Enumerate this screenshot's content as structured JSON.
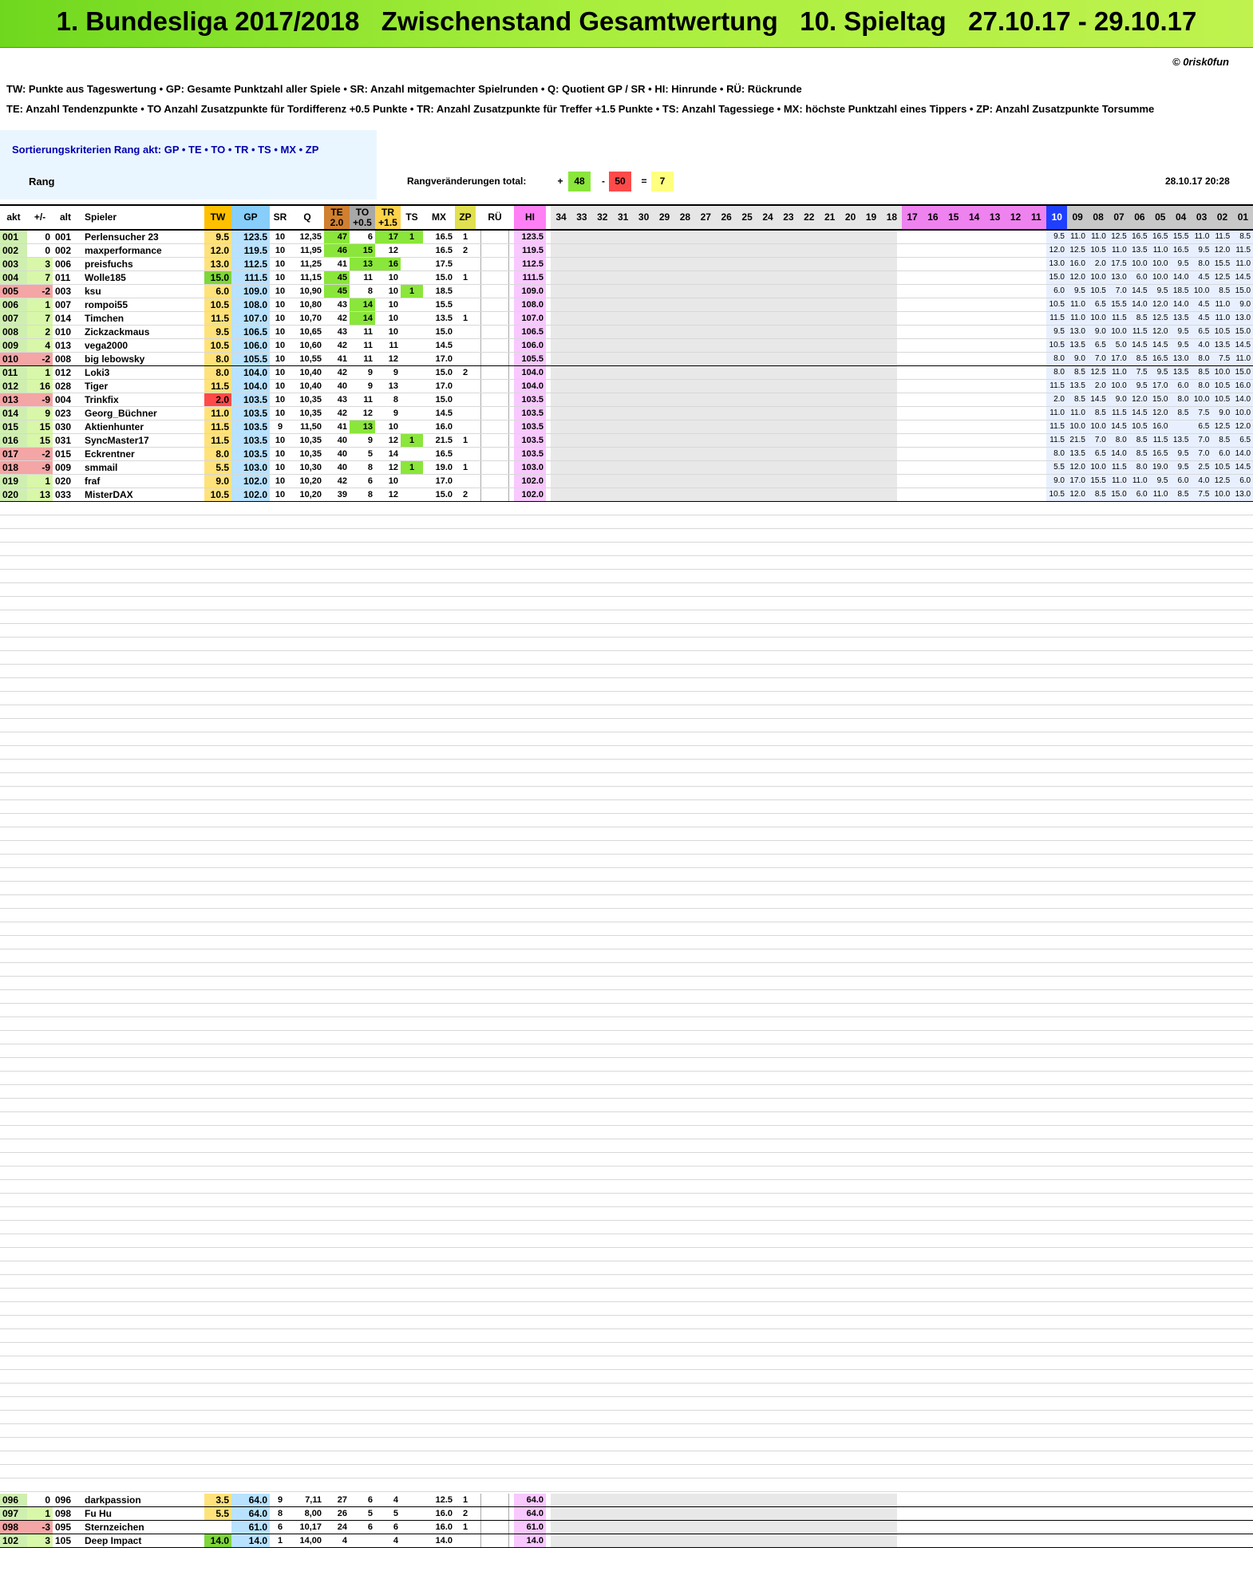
{
  "title": "1. Bundesliga 2017/2018   Zwischenstand Gesamtwertung   10. Spieltag   27.10.17 - 29.10.17",
  "copyright": "© 0risk0fun",
  "legend_line1": "TW: Punkte aus Tageswertung  •  GP: Gesamte Punktzahl aller Spiele  •  SR: Anzahl mitgemachter Spielrunden  •  Q: Quotient GP / SR  •  HI: Hinrunde  •  RÜ: Rückrunde",
  "legend_line2": "TE: Anzahl Tendenzpunkte  •  TO Anzahl Zusatzpunkte für Tordifferenz +0.5 Punkte  •  TR: Anzahl Zusatzpunkte für Treffer +1.5 Punkte  •  TS: Anzahl Tagessiege  •  MX: höchste Punktzahl eines Tippers  •  ZP: Anzahl Zusatzpunkte Torsumme",
  "sort_label": "Sortierungskriterien Rang akt:  GP  •  TE  •  TO  •  TR  •  TS  •  MX  •  ZP",
  "rang_label": "Rang",
  "changes": {
    "label": "Rangveränderungen total:",
    "plus_sign": "+",
    "plus": "48",
    "minus_sign": "-",
    "minus": "50",
    "eq_sign": "=",
    "eq": "7"
  },
  "date": "28.10.17  20:28",
  "headers": {
    "akt": "akt",
    "pm": "+/-",
    "alt": "alt",
    "spieler": "Spieler",
    "tw": "TW",
    "gp": "GP",
    "sr": "SR",
    "q": "Q",
    "te": "TE\n2.0",
    "to": "TO\n+0.5",
    "tr": "TR\n+1.5",
    "ts": "TS",
    "mx": "MX",
    "zp": "ZP",
    "ru": "RÜ",
    "hi": "HI"
  },
  "rounds_new": [
    "34",
    "33",
    "32",
    "31",
    "30",
    "29",
    "28",
    "27",
    "26",
    "25",
    "24",
    "23",
    "22",
    "21",
    "20",
    "19",
    "18"
  ],
  "rounds_old": [
    "17",
    "16",
    "15",
    "14",
    "13",
    "12",
    "11",
    "10",
    "09",
    "08",
    "07",
    "06",
    "05",
    "04",
    "03",
    "02",
    "01"
  ],
  "current_round": "10",
  "colors": {
    "banner": "#8ee82a",
    "tw": "#ffc000",
    "gp": "#87cefa",
    "hi": "#ff7ff5",
    "highlight": "#8ae63a",
    "down": "#f4a5a5"
  },
  "rows": [
    {
      "akt": "001",
      "pm": "0",
      "alt": "001",
      "name": "Perlensucher 23",
      "tw": "9.5",
      "gp": "123.5",
      "sr": "10",
      "q": "12,35",
      "te": "47",
      "to": "6",
      "tr": "17",
      "ts": "1",
      "mx": "16.5",
      "zp": "1",
      "hi": "123.5",
      "r": [
        "9.5",
        "11.0",
        "11.0",
        "12.5",
        "16.5",
        "16.5",
        "15.5",
        "11.0",
        "11.5",
        "8.5"
      ]
    },
    {
      "akt": "002",
      "pm": "0",
      "alt": "002",
      "name": "maxperformance",
      "tw": "12.0",
      "gp": "119.5",
      "sr": "10",
      "q": "11,95",
      "te": "46",
      "to": "15",
      "tr": "12",
      "ts": "",
      "mx": "16.5",
      "zp": "2",
      "hi": "119.5",
      "r": [
        "12.0",
        "12.5",
        "10.5",
        "11.0",
        "13.5",
        "11.0",
        "16.5",
        "9.5",
        "12.0",
        "11.5"
      ]
    },
    {
      "akt": "003",
      "pm": "3",
      "alt": "006",
      "name": "preisfuchs",
      "tw": "13.0",
      "gp": "112.5",
      "sr": "10",
      "q": "11,25",
      "te": "41",
      "to": "13",
      "tr": "16",
      "ts": "",
      "mx": "17.5",
      "zp": "",
      "hi": "112.5",
      "r": [
        "13.0",
        "16.0",
        "2.0",
        "17.5",
        "10.0",
        "10.0",
        "9.5",
        "8.0",
        "15.5",
        "11.0"
      ]
    },
    {
      "akt": "004",
      "pm": "7",
      "alt": "011",
      "name": "Wolle185",
      "tw": "15.0",
      "gp": "111.5",
      "sr": "10",
      "q": "11,15",
      "te": "45",
      "to": "11",
      "tr": "10",
      "ts": "",
      "mx": "15.0",
      "zp": "1",
      "hi": "111.5",
      "r": [
        "15.0",
        "12.0",
        "10.0",
        "13.0",
        "6.0",
        "10.0",
        "14.0",
        "4.5",
        "12.5",
        "14.5"
      ]
    },
    {
      "akt": "005",
      "pm": "-2",
      "alt": "003",
      "name": "ksu",
      "tw": "6.0",
      "gp": "109.0",
      "sr": "10",
      "q": "10,90",
      "te": "45",
      "to": "8",
      "tr": "10",
      "ts": "1",
      "mx": "18.5",
      "zp": "",
      "hi": "109.0",
      "r": [
        "6.0",
        "9.5",
        "10.5",
        "7.0",
        "14.5",
        "9.5",
        "18.5",
        "10.0",
        "8.5",
        "15.0"
      ]
    },
    {
      "akt": "006",
      "pm": "1",
      "alt": "007",
      "name": "rompoi55",
      "tw": "10.5",
      "gp": "108.0",
      "sr": "10",
      "q": "10,80",
      "te": "43",
      "to": "14",
      "tr": "10",
      "ts": "",
      "mx": "15.5",
      "zp": "",
      "hi": "108.0",
      "r": [
        "10.5",
        "11.0",
        "6.5",
        "15.5",
        "14.0",
        "12.0",
        "14.0",
        "4.5",
        "11.0",
        "9.0"
      ]
    },
    {
      "akt": "007",
      "pm": "7",
      "alt": "014",
      "name": "Timchen",
      "tw": "11.5",
      "gp": "107.0",
      "sr": "10",
      "q": "10,70",
      "te": "42",
      "to": "14",
      "tr": "10",
      "ts": "",
      "mx": "13.5",
      "zp": "1",
      "hi": "107.0",
      "r": [
        "11.5",
        "11.0",
        "10.0",
        "11.5",
        "8.5",
        "12.5",
        "13.5",
        "4.5",
        "11.0",
        "13.0"
      ]
    },
    {
      "akt": "008",
      "pm": "2",
      "alt": "010",
      "name": "Zickzackmaus",
      "tw": "9.5",
      "gp": "106.5",
      "sr": "10",
      "q": "10,65",
      "te": "43",
      "to": "11",
      "tr": "10",
      "ts": "",
      "mx": "15.0",
      "zp": "",
      "hi": "106.5",
      "r": [
        "9.5",
        "13.0",
        "9.0",
        "10.0",
        "11.5",
        "12.0",
        "9.5",
        "6.5",
        "10.5",
        "15.0"
      ]
    },
    {
      "akt": "009",
      "pm": "4",
      "alt": "013",
      "name": "vega2000",
      "tw": "10.5",
      "gp": "106.0",
      "sr": "10",
      "q": "10,60",
      "te": "42",
      "to": "11",
      "tr": "11",
      "ts": "",
      "mx": "14.5",
      "zp": "",
      "hi": "106.0",
      "r": [
        "10.5",
        "13.5",
        "6.5",
        "5.0",
        "14.5",
        "14.5",
        "9.5",
        "4.0",
        "13.5",
        "14.5"
      ]
    },
    {
      "akt": "010",
      "pm": "-2",
      "alt": "008",
      "name": "big lebowsky",
      "tw": "8.0",
      "gp": "105.5",
      "sr": "10",
      "q": "10,55",
      "te": "41",
      "to": "11",
      "tr": "12",
      "ts": "",
      "mx": "17.0",
      "zp": "",
      "hi": "105.5",
      "r": [
        "8.0",
        "9.0",
        "7.0",
        "17.0",
        "8.5",
        "16.5",
        "13.0",
        "8.0",
        "7.5",
        "11.0"
      ]
    },
    {
      "akt": "011",
      "pm": "1",
      "alt": "012",
      "name": "Loki3",
      "tw": "8.0",
      "gp": "104.0",
      "sr": "10",
      "q": "10,40",
      "te": "42",
      "to": "9",
      "tr": "9",
      "ts": "",
      "mx": "15.0",
      "zp": "2",
      "hi": "104.0",
      "r": [
        "8.0",
        "8.5",
        "12.5",
        "11.0",
        "7.5",
        "9.5",
        "13.5",
        "8.5",
        "10.0",
        "15.0"
      ]
    },
    {
      "akt": "012",
      "pm": "16",
      "alt": "028",
      "name": "Tiger",
      "tw": "11.5",
      "gp": "104.0",
      "sr": "10",
      "q": "10,40",
      "te": "40",
      "to": "9",
      "tr": "13",
      "ts": "",
      "mx": "17.0",
      "zp": "",
      "hi": "104.0",
      "r": [
        "11.5",
        "13.5",
        "2.0",
        "10.0",
        "9.5",
        "17.0",
        "6.0",
        "8.0",
        "10.5",
        "16.0"
      ]
    },
    {
      "akt": "013",
      "pm": "-9",
      "alt": "004",
      "name": "Trinkfix",
      "tw": "2.0",
      "gp": "103.5",
      "sr": "10",
      "q": "10,35",
      "te": "43",
      "to": "11",
      "tr": "8",
      "ts": "",
      "mx": "15.0",
      "zp": "",
      "hi": "103.5",
      "r": [
        "2.0",
        "8.5",
        "14.5",
        "9.0",
        "12.0",
        "15.0",
        "8.0",
        "10.0",
        "10.5",
        "14.0"
      ]
    },
    {
      "akt": "014",
      "pm": "9",
      "alt": "023",
      "name": "Georg_Büchner",
      "tw": "11.0",
      "gp": "103.5",
      "sr": "10",
      "q": "10,35",
      "te": "42",
      "to": "12",
      "tr": "9",
      "ts": "",
      "mx": "14.5",
      "zp": "",
      "hi": "103.5",
      "r": [
        "11.0",
        "11.0",
        "8.5",
        "11.5",
        "14.5",
        "12.0",
        "8.5",
        "7.5",
        "9.0",
        "10.0"
      ]
    },
    {
      "akt": "015",
      "pm": "15",
      "alt": "030",
      "name": "Aktienhunter",
      "tw": "11.5",
      "gp": "103.5",
      "sr": "9",
      "q": "11,50",
      "te": "41",
      "to": "13",
      "tr": "10",
      "ts": "",
      "mx": "16.0",
      "zp": "",
      "hi": "103.5",
      "r": [
        "11.5",
        "10.0",
        "10.0",
        "14.5",
        "10.5",
        "16.0",
        "",
        "6.5",
        "12.5",
        "12.0"
      ]
    },
    {
      "akt": "016",
      "pm": "15",
      "alt": "031",
      "name": "SyncMaster17",
      "tw": "11.5",
      "gp": "103.5",
      "sr": "10",
      "q": "10,35",
      "te": "40",
      "to": "9",
      "tr": "12",
      "ts": "1",
      "mx": "21.5",
      "zp": "1",
      "hi": "103.5",
      "r": [
        "11.5",
        "21.5",
        "7.0",
        "8.0",
        "8.5",
        "11.5",
        "13.5",
        "7.0",
        "8.5",
        "6.5"
      ]
    },
    {
      "akt": "017",
      "pm": "-2",
      "alt": "015",
      "name": "Eckrentner",
      "tw": "8.0",
      "gp": "103.5",
      "sr": "10",
      "q": "10,35",
      "te": "40",
      "to": "5",
      "tr": "14",
      "ts": "",
      "mx": "16.5",
      "zp": "",
      "hi": "103.5",
      "r": [
        "8.0",
        "13.5",
        "6.5",
        "14.0",
        "8.5",
        "16.5",
        "9.5",
        "7.0",
        "6.0",
        "14.0"
      ]
    },
    {
      "akt": "018",
      "pm": "-9",
      "alt": "009",
      "name": "smmail",
      "tw": "5.5",
      "gp": "103.0",
      "sr": "10",
      "q": "10,30",
      "te": "40",
      "to": "8",
      "tr": "12",
      "ts": "1",
      "mx": "19.0",
      "zp": "1",
      "hi": "103.0",
      "r": [
        "5.5",
        "12.0",
        "10.0",
        "11.5",
        "8.0",
        "19.0",
        "9.5",
        "2.5",
        "10.5",
        "14.5"
      ]
    },
    {
      "akt": "019",
      "pm": "1",
      "alt": "020",
      "name": "fraf",
      "tw": "9.0",
      "gp": "102.0",
      "sr": "10",
      "q": "10,20",
      "te": "42",
      "to": "6",
      "tr": "10",
      "ts": "",
      "mx": "17.0",
      "zp": "",
      "hi": "102.0",
      "r": [
        "9.0",
        "17.0",
        "15.5",
        "11.0",
        "11.0",
        "9.5",
        "6.0",
        "4.0",
        "12.5",
        "6.0"
      ]
    },
    {
      "akt": "020",
      "pm": "13",
      "alt": "033",
      "name": "MisterDAX",
      "tw": "10.5",
      "gp": "102.0",
      "sr": "10",
      "q": "10,20",
      "te": "39",
      "to": "8",
      "tr": "12",
      "ts": "",
      "mx": "15.0",
      "zp": "2",
      "hi": "102.0",
      "r": [
        "10.5",
        "12.0",
        "8.5",
        "15.0",
        "6.0",
        "11.0",
        "8.5",
        "7.5",
        "10.0",
        "13.0"
      ]
    }
  ],
  "footer_rows": [
    {
      "akt": "096",
      "pm": "0",
      "alt": "096",
      "name": "darkpassion",
      "tw": "3.5",
      "gp": "64.0",
      "sr": "9",
      "q": "7,11",
      "te": "27",
      "to": "6",
      "tr": "4",
      "ts": "",
      "mx": "12.5",
      "zp": "1",
      "hi": "64.0"
    },
    {
      "akt": "097",
      "pm": "1",
      "alt": "098",
      "name": "Fu Hu",
      "tw": "5.5",
      "gp": "64.0",
      "sr": "8",
      "q": "8,00",
      "te": "26",
      "to": "5",
      "tr": "5",
      "ts": "",
      "mx": "16.0",
      "zp": "2",
      "hi": "64.0"
    },
    {
      "akt": "098",
      "pm": "-3",
      "alt": "095",
      "name": "Sternzeichen",
      "tw": "",
      "gp": "61.0",
      "sr": "6",
      "q": "10,17",
      "te": "24",
      "to": "6",
      "tr": "6",
      "ts": "",
      "mx": "16.0",
      "zp": "1",
      "hi": "61.0"
    },
    {
      "akt": "102",
      "pm": "3",
      "alt": "105",
      "name": "Deep Impact",
      "tw": "14.0",
      "gp": "14.0",
      "sr": "1",
      "q": "14,00",
      "te": "4",
      "to": "",
      "tr": "4",
      "ts": "",
      "mx": "14.0",
      "zp": "",
      "hi": "14.0"
    }
  ]
}
